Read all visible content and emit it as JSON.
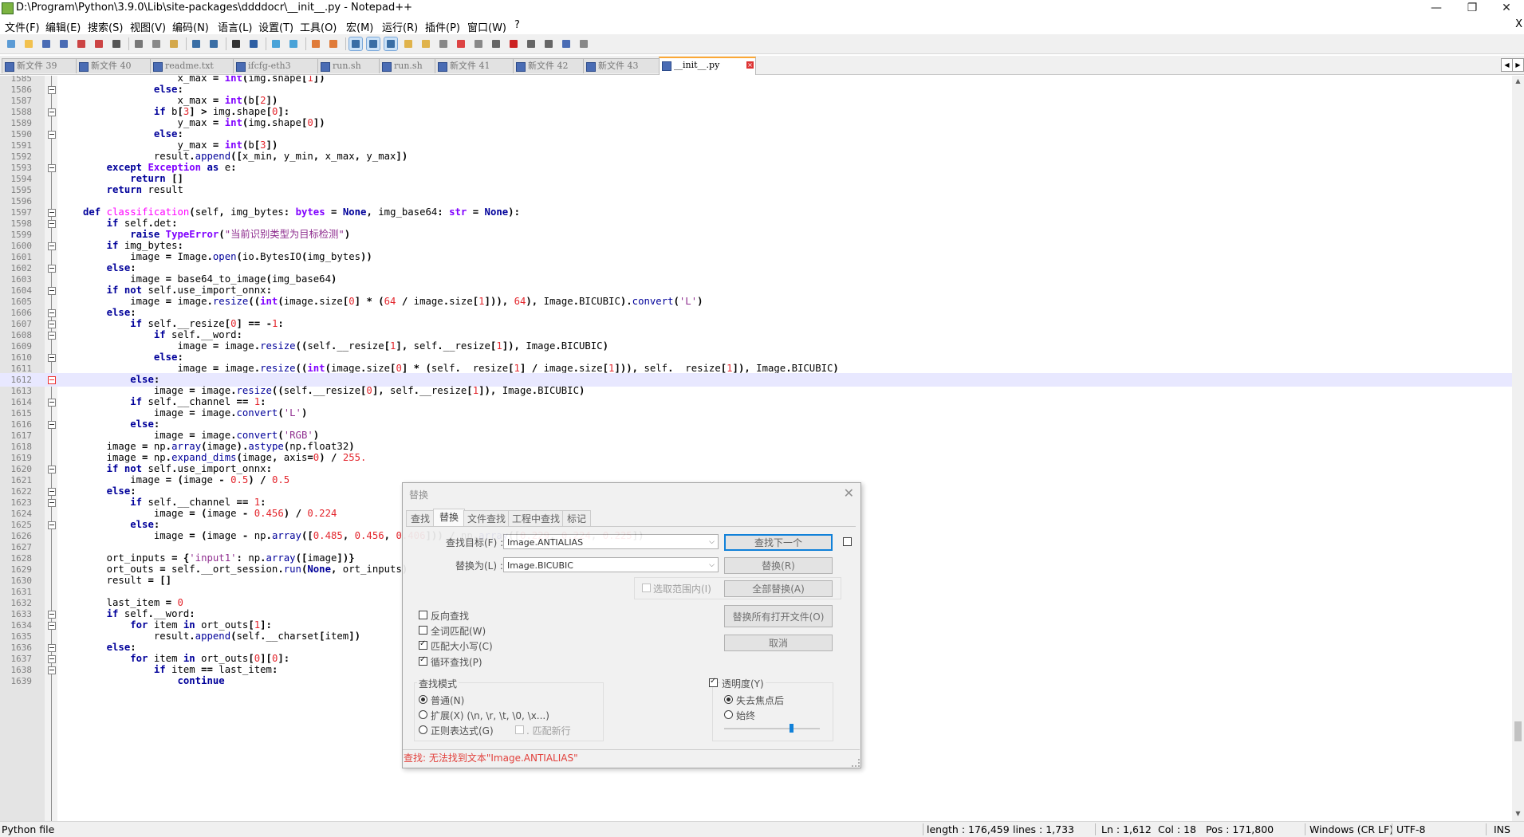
{
  "window": {
    "title": "D:\\Program\\Python\\3.9.0\\Lib\\site-packages\\ddddocr\\__init__.py - Notepad++",
    "min_glyph": "—",
    "max_glyph": "❐",
    "close_glyph": "✕"
  },
  "menu": {
    "items": [
      "文件(F)",
      "编辑(E)",
      "搜索(S)",
      "视图(V)",
      "编码(N)",
      "语言(L)",
      "设置(T)",
      "工具(O)",
      "宏(M)",
      "运行(R)",
      "插件(P)",
      "窗口(W)",
      "?"
    ],
    "close_glyph": "X"
  },
  "toolbar": {
    "icons": [
      "new-file-icon",
      "open-file-icon",
      "save-icon",
      "save-all-icon",
      "close-icon",
      "close-all-icon",
      "print-icon",
      "cut-icon",
      "copy-icon",
      "paste-icon",
      "undo-icon",
      "redo-icon",
      "find-icon",
      "replace-icon",
      "zoom-in-icon",
      "zoom-out-icon",
      "sync-vertical-icon",
      "sync-horizontal-icon",
      "word-wrap-icon",
      "show-all-chars-icon",
      "indent-guide-icon",
      "language-define-icon",
      "doc-map-icon",
      "function-list-icon",
      "folder-workspace-icon",
      "doc-switcher-icon",
      "monitoring-icon",
      "record-macro-icon",
      "stop-record-icon",
      "play-macro-icon",
      "run-macro-multiple-icon",
      "save-macro-icon"
    ]
  },
  "tabs": [
    {
      "label": "新文件 39",
      "active": false
    },
    {
      "label": "新文件 40",
      "active": false
    },
    {
      "label": "readme.txt",
      "active": false
    },
    {
      "label": "ifcfg-eth3",
      "active": false
    },
    {
      "label": "run.sh",
      "active": false
    },
    {
      "label": "run.sh",
      "active": false
    },
    {
      "label": "新文件 41",
      "active": false
    },
    {
      "label": "新文件 42",
      "active": false
    },
    {
      "label": "新文件 43",
      "active": false
    },
    {
      "label": "__init__.py",
      "active": true
    }
  ],
  "editor": {
    "current_line": 1612,
    "lines": [
      {
        "n": 1585,
        "fold": false,
        "code": "                x_max = int(img.shape[1])"
      },
      {
        "n": 1586,
        "fold": true,
        "code": "            else:"
      },
      {
        "n": 1587,
        "fold": false,
        "code": "                x_max = int(b[2])"
      },
      {
        "n": 1588,
        "fold": true,
        "code": "            if b[3] > img.shape[0]:"
      },
      {
        "n": 1589,
        "fold": false,
        "code": "                y_max = int(img.shape[0])"
      },
      {
        "n": 1590,
        "fold": true,
        "code": "            else:"
      },
      {
        "n": 1591,
        "fold": false,
        "code": "                y_max = int(b[3])"
      },
      {
        "n": 1592,
        "fold": false,
        "code": "            result.append([x_min, y_min, x_max, y_max])"
      },
      {
        "n": 1593,
        "fold": true,
        "code": "    except Exception as e:"
      },
      {
        "n": 1594,
        "fold": false,
        "code": "        return []"
      },
      {
        "n": 1595,
        "fold": false,
        "code": "    return result"
      },
      {
        "n": 1596,
        "fold": false,
        "code": ""
      },
      {
        "n": 1597,
        "fold": true,
        "code": "def classification(self, img_bytes: bytes = None, img_base64: str = None):"
      },
      {
        "n": 1598,
        "fold": true,
        "code": "    if self.det:"
      },
      {
        "n": 1599,
        "fold": false,
        "code": "        raise TypeError(\"当前识别类型为目标检测\")"
      },
      {
        "n": 1600,
        "fold": true,
        "code": "    if img_bytes:"
      },
      {
        "n": 1601,
        "fold": false,
        "code": "        image = Image.open(io.BytesIO(img_bytes))"
      },
      {
        "n": 1602,
        "fold": true,
        "code": "    else:"
      },
      {
        "n": 1603,
        "fold": false,
        "code": "        image = base64_to_image(img_base64)"
      },
      {
        "n": 1604,
        "fold": true,
        "code": "    if not self.use_import_onnx:"
      },
      {
        "n": 1605,
        "fold": false,
        "code": "        image = image.resize((int(image.size[0] * (64 / image.size[1])), 64), Image.BICUBIC).convert('L')"
      },
      {
        "n": 1606,
        "fold": true,
        "code": "    else:"
      },
      {
        "n": 1607,
        "fold": true,
        "code": "        if self.__resize[0] == -1:"
      },
      {
        "n": 1608,
        "fold": true,
        "code": "            if self.__word:"
      },
      {
        "n": 1609,
        "fold": false,
        "code": "                image = image.resize((self.__resize[1], self.__resize[1]), Image.BICUBIC)"
      },
      {
        "n": 1610,
        "fold": true,
        "code": "            else:"
      },
      {
        "n": 1611,
        "fold": false,
        "code": "                image = image.resize((int(image.size[0] * (self.__resize[1] / image.size[1])), self.__resize[1]), Image.BICUBIC)"
      },
      {
        "n": 1612,
        "fold": true,
        "code": "        else:"
      },
      {
        "n": 1613,
        "fold": false,
        "code": "            image = image.resize((self.__resize[0], self.__resize[1]), Image.BICUBIC)"
      },
      {
        "n": 1614,
        "fold": true,
        "code": "        if self.__channel == 1:"
      },
      {
        "n": 1615,
        "fold": false,
        "code": "            image = image.convert('L')"
      },
      {
        "n": 1616,
        "fold": true,
        "code": "        else:"
      },
      {
        "n": 1617,
        "fold": false,
        "code": "            image = image.convert('RGB')"
      },
      {
        "n": 1618,
        "fold": false,
        "code": "    image = np.array(image).astype(np.float32)"
      },
      {
        "n": 1619,
        "fold": false,
        "code": "    image = np.expand_dims(image, axis=0) / 255."
      },
      {
        "n": 1620,
        "fold": true,
        "code": "    if not self.use_import_onnx:"
      },
      {
        "n": 1621,
        "fold": false,
        "code": "        image = (image - 0.5) / 0.5"
      },
      {
        "n": 1622,
        "fold": true,
        "code": "    else:"
      },
      {
        "n": 1623,
        "fold": true,
        "code": "        if self.__channel == 1:"
      },
      {
        "n": 1624,
        "fold": false,
        "code": "            image = (image - 0.456) / 0.224"
      },
      {
        "n": 1625,
        "fold": true,
        "code": "        else:"
      },
      {
        "n": 1626,
        "fold": false,
        "code": "            image = (image - np.array([0.485, 0.456, 0.406])) / np.array([0.229, 0.224, 0.225])"
      },
      {
        "n": 1627,
        "fold": false,
        "code": ""
      },
      {
        "n": 1628,
        "fold": false,
        "code": "    ort_inputs = {'input1': np.array([image])}"
      },
      {
        "n": 1629,
        "fold": false,
        "code": "    ort_outs = self.__ort_session.run(None, ort_inputs)"
      },
      {
        "n": 1630,
        "fold": false,
        "code": "    result = []"
      },
      {
        "n": 1631,
        "fold": false,
        "code": ""
      },
      {
        "n": 1632,
        "fold": false,
        "code": "    last_item = 0"
      },
      {
        "n": 1633,
        "fold": true,
        "code": "    if self.__word:"
      },
      {
        "n": 1634,
        "fold": true,
        "code": "        for item in ort_outs[1]:"
      },
      {
        "n": 1635,
        "fold": false,
        "code": "            result.append(self.__charset[item])"
      },
      {
        "n": 1636,
        "fold": true,
        "code": "    else:"
      },
      {
        "n": 1637,
        "fold": true,
        "code": "        for item in ort_outs[0][0]:"
      },
      {
        "n": 1638,
        "fold": true,
        "code": "            if item == last_item:"
      },
      {
        "n": 1639,
        "fold": false,
        "code": "                continue"
      }
    ]
  },
  "dialog": {
    "title": "替换",
    "tabs": [
      "查找",
      "替换",
      "文件查找",
      "工程中查找",
      "标记"
    ],
    "active_tab": "替换",
    "find_label": "查找目标(F) :",
    "find_value": "Image.ANTIALIAS",
    "replace_label": "替换为(L) :",
    "replace_value": "Image.BICUBIC",
    "btn_find_next": "查找下一个",
    "btn_replace": "替换(R)",
    "btn_replace_all": "全部替换(A)",
    "btn_replace_all_open": "替换所有打开文件(O)",
    "btn_cancel": "取消",
    "in_selection": "选取范围内(I)",
    "opt_backward": "反向查找",
    "opt_whole_word": "全词匹配(W)",
    "opt_match_case": "匹配大小写(C)",
    "opt_wrap": "循环查找(P)",
    "search_mode_title": "查找模式",
    "mode_normal": "普通(N)",
    "mode_extended": "扩展(X) (\\n, \\r, \\t, \\0, \\x...)",
    "mode_regex": "正则表达式(G)",
    "dot_newline": ". 匹配新行",
    "transparency": "透明度(Y)",
    "trans_on_lose_focus": "失去焦点后",
    "trans_always": "始终",
    "status": "查找:  无法找到文本\"Image.ANTIALIAS\"",
    "close_glyph": "✕",
    "transparency_level": 0.7
  },
  "statusbar": {
    "filetype": "Python file",
    "length": "length : 176,459",
    "lines": "lines : 1,733",
    "ln": "Ln : 1,612",
    "col": "Col : 18",
    "pos": "Pos : 171,800",
    "eol": "Windows (CR LF)",
    "encoding": "UTF-8",
    "mode": "INS"
  },
  "colors": {
    "keyword": "#00009a",
    "number": "#e3262d",
    "string": "#8f2e8f",
    "function": "#ff00ff",
    "current_line": "#e8e8ff",
    "status_error": "#e0332e",
    "active_tab_accent": "#fca835"
  }
}
